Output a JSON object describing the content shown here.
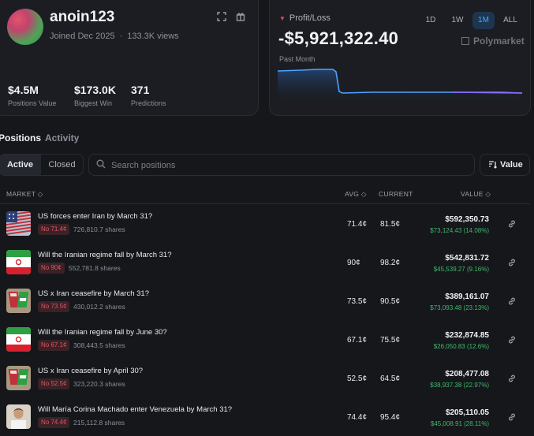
{
  "profile": {
    "username": "anoin123",
    "joined": "Joined Dec 2025",
    "views": "133.3K views",
    "stats": [
      {
        "value": "$4.5M",
        "label": "Positions Value"
      },
      {
        "value": "$173.0K",
        "label": "Biggest Win"
      },
      {
        "value": "371",
        "label": "Predictions"
      }
    ]
  },
  "pnl": {
    "label": "Profit/Loss",
    "value": "-$5,921,322.40",
    "period": "Past Month",
    "ranges": [
      "1D",
      "1W",
      "1M",
      "ALL"
    ],
    "active_range": "1M",
    "brand": "Polymarket",
    "accent_color": "#4ea3ff",
    "loss_color": "#e04c5a"
  },
  "tabs": {
    "positions": "Positions",
    "activity": "Activity"
  },
  "filters": {
    "active": "Active",
    "closed": "Closed",
    "search_placeholder": "Search positions",
    "sort_label": "Value"
  },
  "table": {
    "headers": {
      "market": "MARKET",
      "avg": "AVG",
      "current": "CURRENT",
      "value": "VALUE"
    },
    "rows": [
      {
        "title": "US forces enter Iran by March 31?",
        "pill": "No 71.4¢",
        "shares": "726,810.7 shares",
        "avg": "71.4¢",
        "current": "81.5¢",
        "value": "$592,350.73",
        "change": "$73,124.43 (14.08%)",
        "thumb": "us-flag"
      },
      {
        "title": "Will the Iranian regime fall by March 31?",
        "pill": "No 90¢",
        "shares": "552,781.8 shares",
        "avg": "90¢",
        "current": "98.2¢",
        "value": "$542,831.72",
        "change": "$45,539.27 (9.16%)",
        "thumb": "iran-flag"
      },
      {
        "title": "US x Iran ceasefire by March 31?",
        "pill": "No 73.5¢",
        "shares": "430,012.2 shares",
        "avg": "73.5¢",
        "current": "90.5¢",
        "value": "$389,161.07",
        "change": "$73,093.48 (23.13%)",
        "thumb": "flags-pair"
      },
      {
        "title": "Will the Iranian regime fall by June 30?",
        "pill": "No 67.1¢",
        "shares": "308,443.5 shares",
        "avg": "67.1¢",
        "current": "75.5¢",
        "value": "$232,874.85",
        "change": "$26,050.83 (12.6%)",
        "thumb": "iran-flag"
      },
      {
        "title": "US x Iran ceasefire by April 30?",
        "pill": "No 52.5¢",
        "shares": "323,220.3 shares",
        "avg": "52.5¢",
        "current": "64.5¢",
        "value": "$208,477.08",
        "change": "$38,937.38 (22.97%)",
        "thumb": "flags-pair"
      },
      {
        "title": "Will María Corina Machado enter Venezuela by March 31?",
        "pill": "No 74.4¢",
        "shares": "215,112.8 shares",
        "avg": "74.4¢",
        "current": "95.4¢",
        "value": "$205,110.05",
        "change": "$45,008.91 (28.11%)",
        "thumb": "portrait"
      }
    ]
  }
}
